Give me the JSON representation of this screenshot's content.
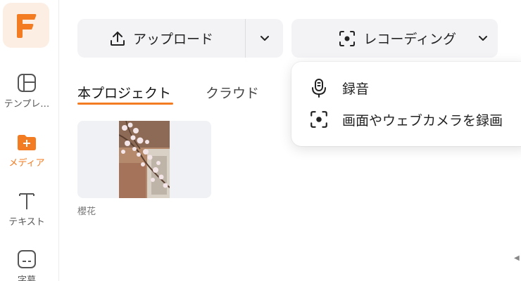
{
  "sidebar": {
    "logo": "F",
    "items": [
      {
        "label": "テンプレ…",
        "icon": "template-icon"
      },
      {
        "label": "メディア",
        "icon": "media-folder-icon"
      },
      {
        "label": "テキスト",
        "icon": "text-icon"
      },
      {
        "label": "字幕",
        "icon": "subtitle-icon"
      }
    ]
  },
  "toolbar": {
    "upload_label": "アップロード",
    "record_label": "レコーディング"
  },
  "tabs": {
    "project": "本プロジェクト",
    "cloud": "クラウド"
  },
  "media": {
    "items": [
      {
        "name": "櫻花"
      }
    ]
  },
  "record_menu": {
    "items": [
      {
        "label": "録音",
        "icon": "microphone-icon"
      },
      {
        "label": "画面やウェブカメラを録画",
        "icon": "screen-record-icon"
      }
    ]
  },
  "colors": {
    "accent": "#f37b22",
    "button_bg": "#f3f3f6"
  }
}
